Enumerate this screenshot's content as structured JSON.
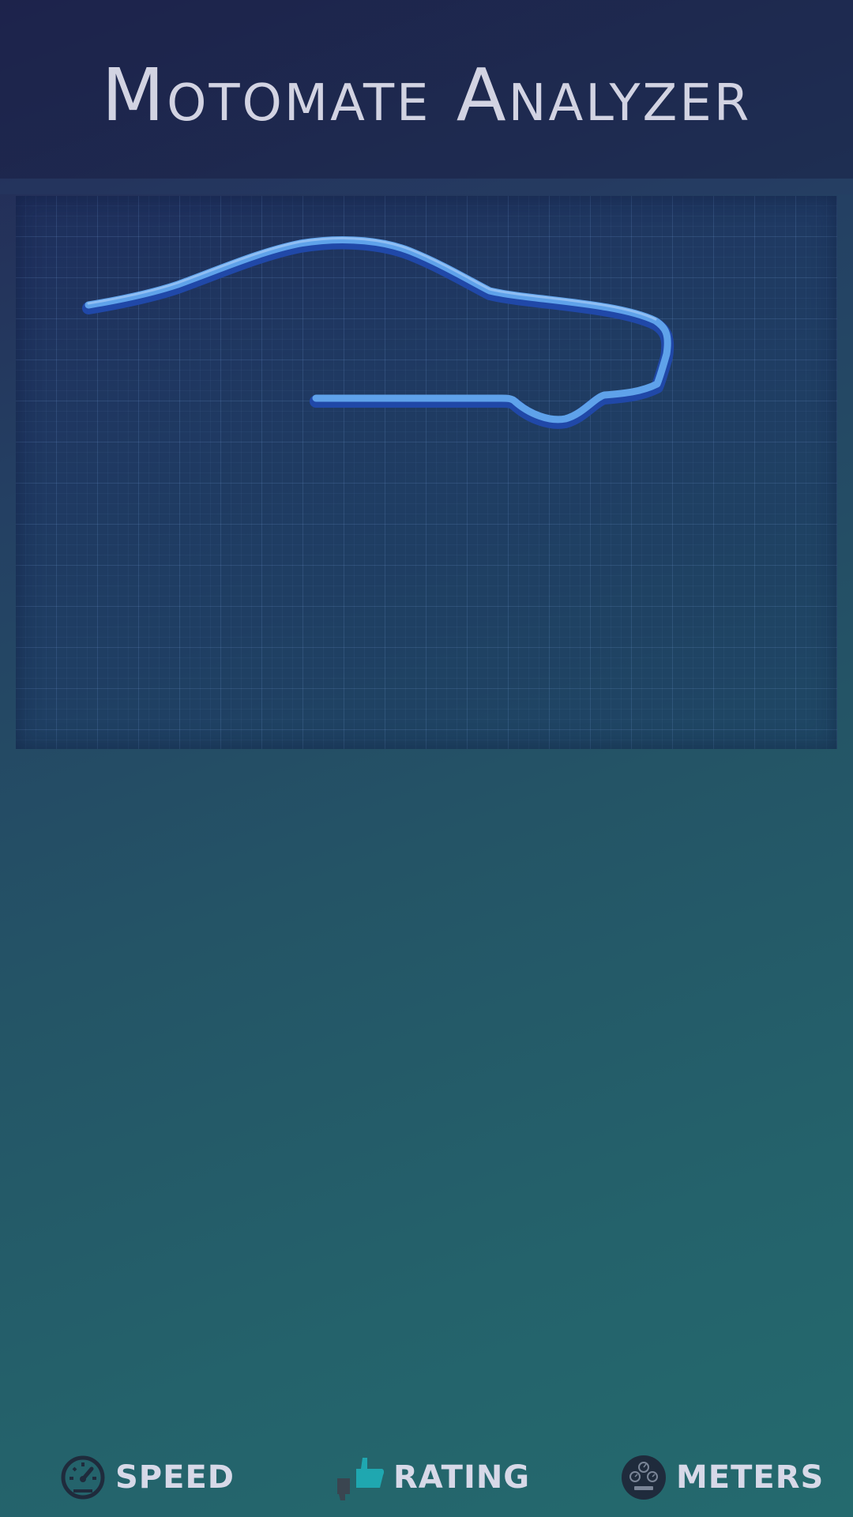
{
  "app": {
    "title": "Motomate Analyzer"
  },
  "colors": {
    "car_outline": "#5fa2ea",
    "car_outline_shadow": "#2048a8",
    "nav_icon_dark": "#1f2b3c",
    "rating_thumb_up": "#1fa7b0",
    "nav_label": "#d7d9e8"
  },
  "nav": {
    "items": [
      {
        "label": "SPEED",
        "icon": "speedometer-icon"
      },
      {
        "label": "RATING",
        "icon": "thumbs-rating-icon"
      },
      {
        "label": "METERS",
        "icon": "gauges-icon"
      }
    ]
  }
}
